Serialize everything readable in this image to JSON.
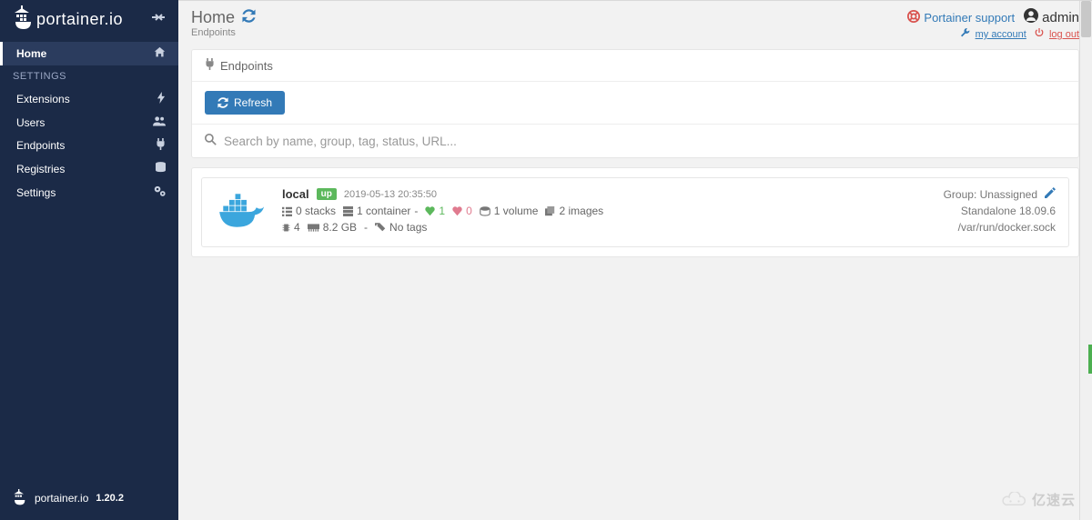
{
  "brand": "portainer.io",
  "version": "1.20.2",
  "sidebar": {
    "items": [
      {
        "label": "Home",
        "icon": "home",
        "active": true
      },
      {
        "label": "SETTINGS",
        "section": true
      },
      {
        "label": "Extensions",
        "icon": "bolt"
      },
      {
        "label": "Users",
        "icon": "users"
      },
      {
        "label": "Endpoints",
        "icon": "plug"
      },
      {
        "label": "Registries",
        "icon": "database"
      },
      {
        "label": "Settings",
        "icon": "gears"
      }
    ]
  },
  "header": {
    "title": "Home",
    "subtitle": "Endpoints",
    "support_label": "Portainer support",
    "username": "admin",
    "my_account_label": "my account",
    "logout_label": "log out"
  },
  "panel": {
    "title": "Endpoints",
    "refresh_label": "Refresh",
    "search_placeholder": "Search by name, group, tag, status, URL..."
  },
  "endpoint": {
    "name": "local",
    "status": "up",
    "timestamp": "2019-05-13 20:35:50",
    "stacks": "0 stacks",
    "containers": "1 container",
    "healthy": "1",
    "unhealthy": "0",
    "volumes": "1 volume",
    "images": "2 images",
    "cpu": "4",
    "memory": "8.2 GB",
    "tags": "No tags",
    "group": "Group: Unassigned",
    "engine": "Standalone 18.09.6",
    "socket": "/var/run/docker.sock"
  },
  "watermark": "亿速云"
}
